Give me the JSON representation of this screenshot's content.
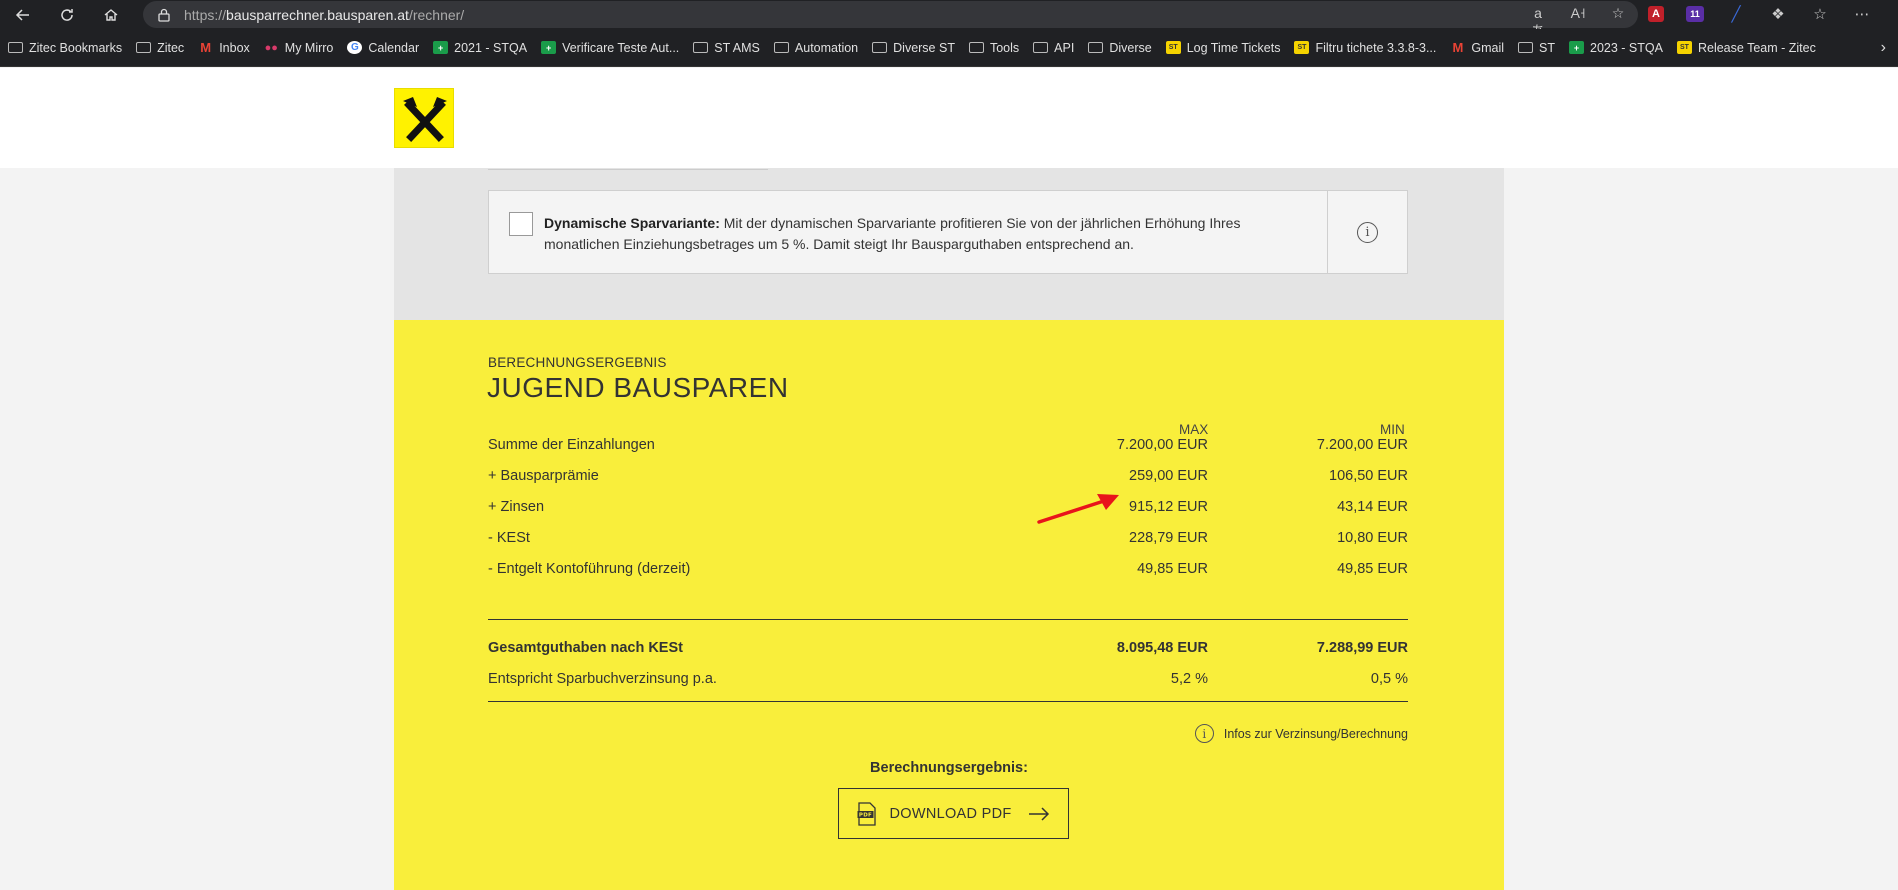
{
  "browser": {
    "url_prefix": "https://",
    "url_host": "bausparrechner.bausparen.at",
    "url_path": "/rechner/",
    "ext_badge": "11"
  },
  "bookmarks": [
    {
      "label": "Zitec Bookmarks",
      "icon": "folder"
    },
    {
      "label": "Zitec",
      "icon": "folder"
    },
    {
      "label": "Inbox",
      "icon": "gmail"
    },
    {
      "label": "My Mirro",
      "icon": "mirro"
    },
    {
      "label": "Calendar",
      "icon": "google"
    },
    {
      "label": "2021 - STQA",
      "icon": "green"
    },
    {
      "label": "Verificare Teste Aut...",
      "icon": "green"
    },
    {
      "label": "ST AMS",
      "icon": "folder"
    },
    {
      "label": "Automation",
      "icon": "folder"
    },
    {
      "label": "Diverse ST",
      "icon": "folder"
    },
    {
      "label": "Tools",
      "icon": "folder"
    },
    {
      "label": "API",
      "icon": "folder"
    },
    {
      "label": "Diverse",
      "icon": "folder"
    },
    {
      "label": "Log Time Tickets",
      "icon": "yellow"
    },
    {
      "label": "Filtru tichete 3.3.8-3...",
      "icon": "yellow"
    },
    {
      "label": "Gmail",
      "icon": "gmail"
    },
    {
      "label": "ST",
      "icon": "folder"
    },
    {
      "label": "2023 - STQA",
      "icon": "green"
    },
    {
      "label": "Release Team - Zitec",
      "icon": "yellow"
    }
  ],
  "dynamic": {
    "title": "Dynamische Sparvariante:",
    "text": "Mit der dynamischen Sparvariante profitieren Sie von der jährlichen Erhöhung Ihres monatlichen Einziehungsbetrages um 5 %. Damit steigt Ihr Bausparguthaben entsprechend an.",
    "checked": false
  },
  "result": {
    "small_title": "BERECHNUNGSERGEBNIS",
    "title": "JUGEND BAUSPAREN",
    "col_max": "MAX",
    "col_min": "MIN",
    "rows": [
      {
        "label": "Summe der Einzahlungen",
        "max": "7.200,00 EUR",
        "min": "7.200,00 EUR"
      },
      {
        "label": "+ Bausparprämie",
        "max": "259,00 EUR",
        "min": "106,50 EUR"
      },
      {
        "label": "+ Zinsen",
        "max": "915,12 EUR",
        "min": "43,14 EUR"
      },
      {
        "label": "- KESt",
        "max": "228,79 EUR",
        "min": "10,80 EUR"
      },
      {
        "label": "- Entgelt Kontoführung (derzeit)",
        "max": "49,85 EUR",
        "min": "49,85 EUR"
      }
    ],
    "total": {
      "label": "Gesamtguthaben nach KESt",
      "max": "8.095,48 EUR",
      "min": "7.288,99 EUR"
    },
    "rate": {
      "label": "Entspricht Sparbuchverzinsung p.a.",
      "max": "5,2 %",
      "min": "0,5 %"
    },
    "infos_link": "Infos zur Verzinsung/Berechnung",
    "pdf_heading": "Berechnungsergebnis:",
    "pdf_button": "DOWNLOAD PDF"
  },
  "colors": {
    "yellow": "#f9ee3b",
    "annotation_arrow": "#e8141b"
  }
}
